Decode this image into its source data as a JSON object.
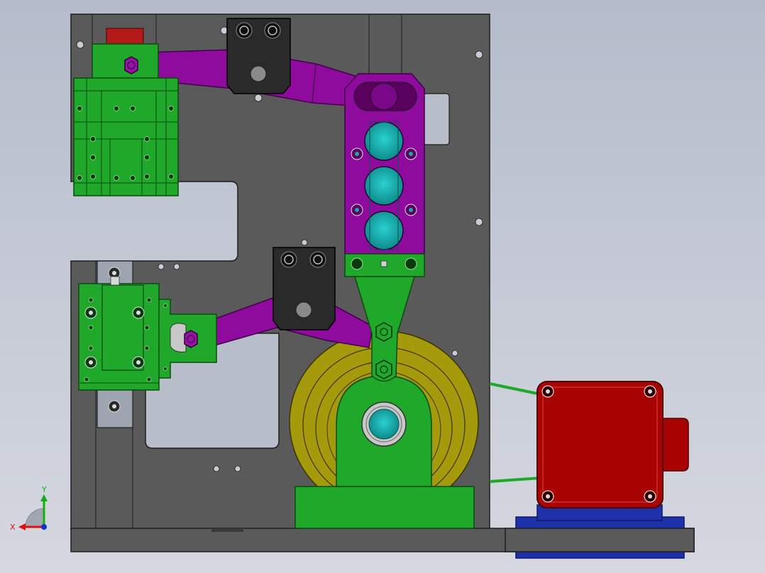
{
  "viewport": {
    "background_top": "#b4bccb",
    "background_bottom": "#d6d8e0"
  },
  "colors": {
    "frame_plate": "#5a5a5a",
    "frame_edge": "#1e1e1e",
    "lever_purple": "#8e0b9e",
    "block_black": "#2a2a2a",
    "bracket_green": "#1fa82a",
    "wheel_yellow": "#a59a0c",
    "motor_red": "#a80404",
    "base_blue": "#1f31a8",
    "bearing_cyan": "#1aa8a8",
    "connector_red": "#b31b1b",
    "slide_gray": "#9ea4b0"
  },
  "components": [
    "base-plate",
    "upper-fixed-block",
    "lower-fixed-block",
    "upper-pivot-block",
    "lower-pivot-block",
    "upper-lever-arm",
    "lower-lever-arm",
    "rocker-plate",
    "connecting-link",
    "cam-wheel",
    "wheel-support-bracket",
    "stepper-motor",
    "motor-mount-base",
    "drive-belts"
  ],
  "triad": {
    "x_label": "X",
    "y_label": "Y",
    "x_color": "#e01010",
    "y_color": "#10b010",
    "z_color": "#1030d0"
  }
}
